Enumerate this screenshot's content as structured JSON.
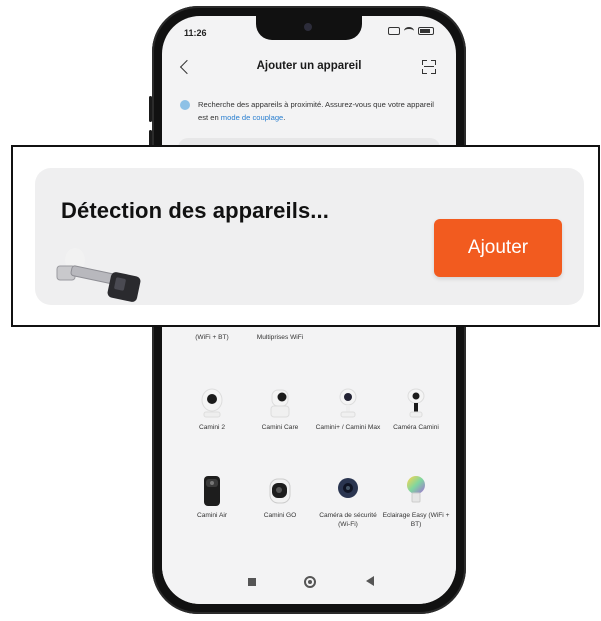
{
  "status_bar": {
    "time": "11:26"
  },
  "app_bar": {
    "title": "Ajouter un appareil"
  },
  "hint": {
    "text": "Recherche des appareils à proximité. Assurez-vous que votre appareil est en ",
    "link": "mode de couplage",
    "suffix": "."
  },
  "devices": [
    {
      "label": "(WiFi + BT)",
      "icon": "bulb-icon"
    },
    {
      "label": "Multiprises WiFi",
      "icon": "power-strip-icon"
    },
    {
      "label": "Camini 2",
      "icon": "camera-icon"
    },
    {
      "label": "Camini Care",
      "icon": "camera-icon"
    },
    {
      "label": "Camini+ / Camini Max",
      "icon": "camera-icon"
    },
    {
      "label": "Caméra Camini",
      "icon": "camera-icon"
    },
    {
      "label": "Camini Air",
      "icon": "camera-icon"
    },
    {
      "label": "Camini GO",
      "icon": "camera-icon"
    },
    {
      "label": "Caméra de sécurité (Wi-Fi)",
      "icon": "camera-icon"
    },
    {
      "label": "Eclairage Easy (WiFi + BT)",
      "icon": "bulb-icon"
    }
  ],
  "callout": {
    "title": "Détection des appareils...",
    "button_label": "Ajouter",
    "device_icon": "smart-lock-icon"
  },
  "colors": {
    "accent": "#f25b1f",
    "link": "#2a7fd0"
  }
}
